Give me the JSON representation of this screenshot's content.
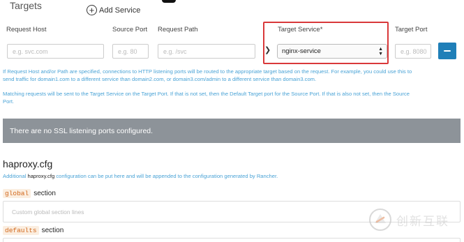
{
  "header": {
    "title": "Targets",
    "add_service_label": "Add Service"
  },
  "columns": {
    "request_host": "Request Host",
    "source_port": "Source Port",
    "request_path": "Request Path",
    "target_service": "Target Service*",
    "target_port": "Target Port"
  },
  "row": {
    "request_host_placeholder": "e.g. svc.com",
    "source_port_placeholder": "e.g. 80",
    "request_path_placeholder": "e.g. /svc",
    "target_service_value": "nginx-service",
    "target_port_placeholder": "e.g. 8080"
  },
  "help": {
    "line1": "If Request Host and/or Path are specified, connections to HTTP listening ports will be routed to the appropriate target based on the request. For example, you could use this to",
    "line2": "send traffic for domain1.com to a different service than domain2.com, or domain3.com/admin to a different service than domain3.com.",
    "line3": "Matching requests will be sent to the Target Service on the Target Port. If that is not set, then the Default Target port for the Source Port. If that is also not set, then the Source",
    "line4": "Port."
  },
  "ssl": {
    "message": "There are no SSL listening ports configured."
  },
  "haproxy": {
    "title": "haproxy.cfg",
    "desc_prefix": "Additional",
    "desc_code": "haproxy.cfg",
    "desc_suffix": "configuration can be put here and will be appended to the configuration generated by Rancher.",
    "global_code": "global",
    "global_suffix": "section",
    "global_placeholder": "Custom global section lines",
    "defaults_code": "defaults",
    "defaults_suffix": "section"
  },
  "watermark": {
    "text": "创新互联"
  },
  "colors": {
    "accent": "#1f7fb8",
    "highlight": "#d9383a",
    "help_text": "#4aa3d6",
    "banner": "#8d9399"
  }
}
